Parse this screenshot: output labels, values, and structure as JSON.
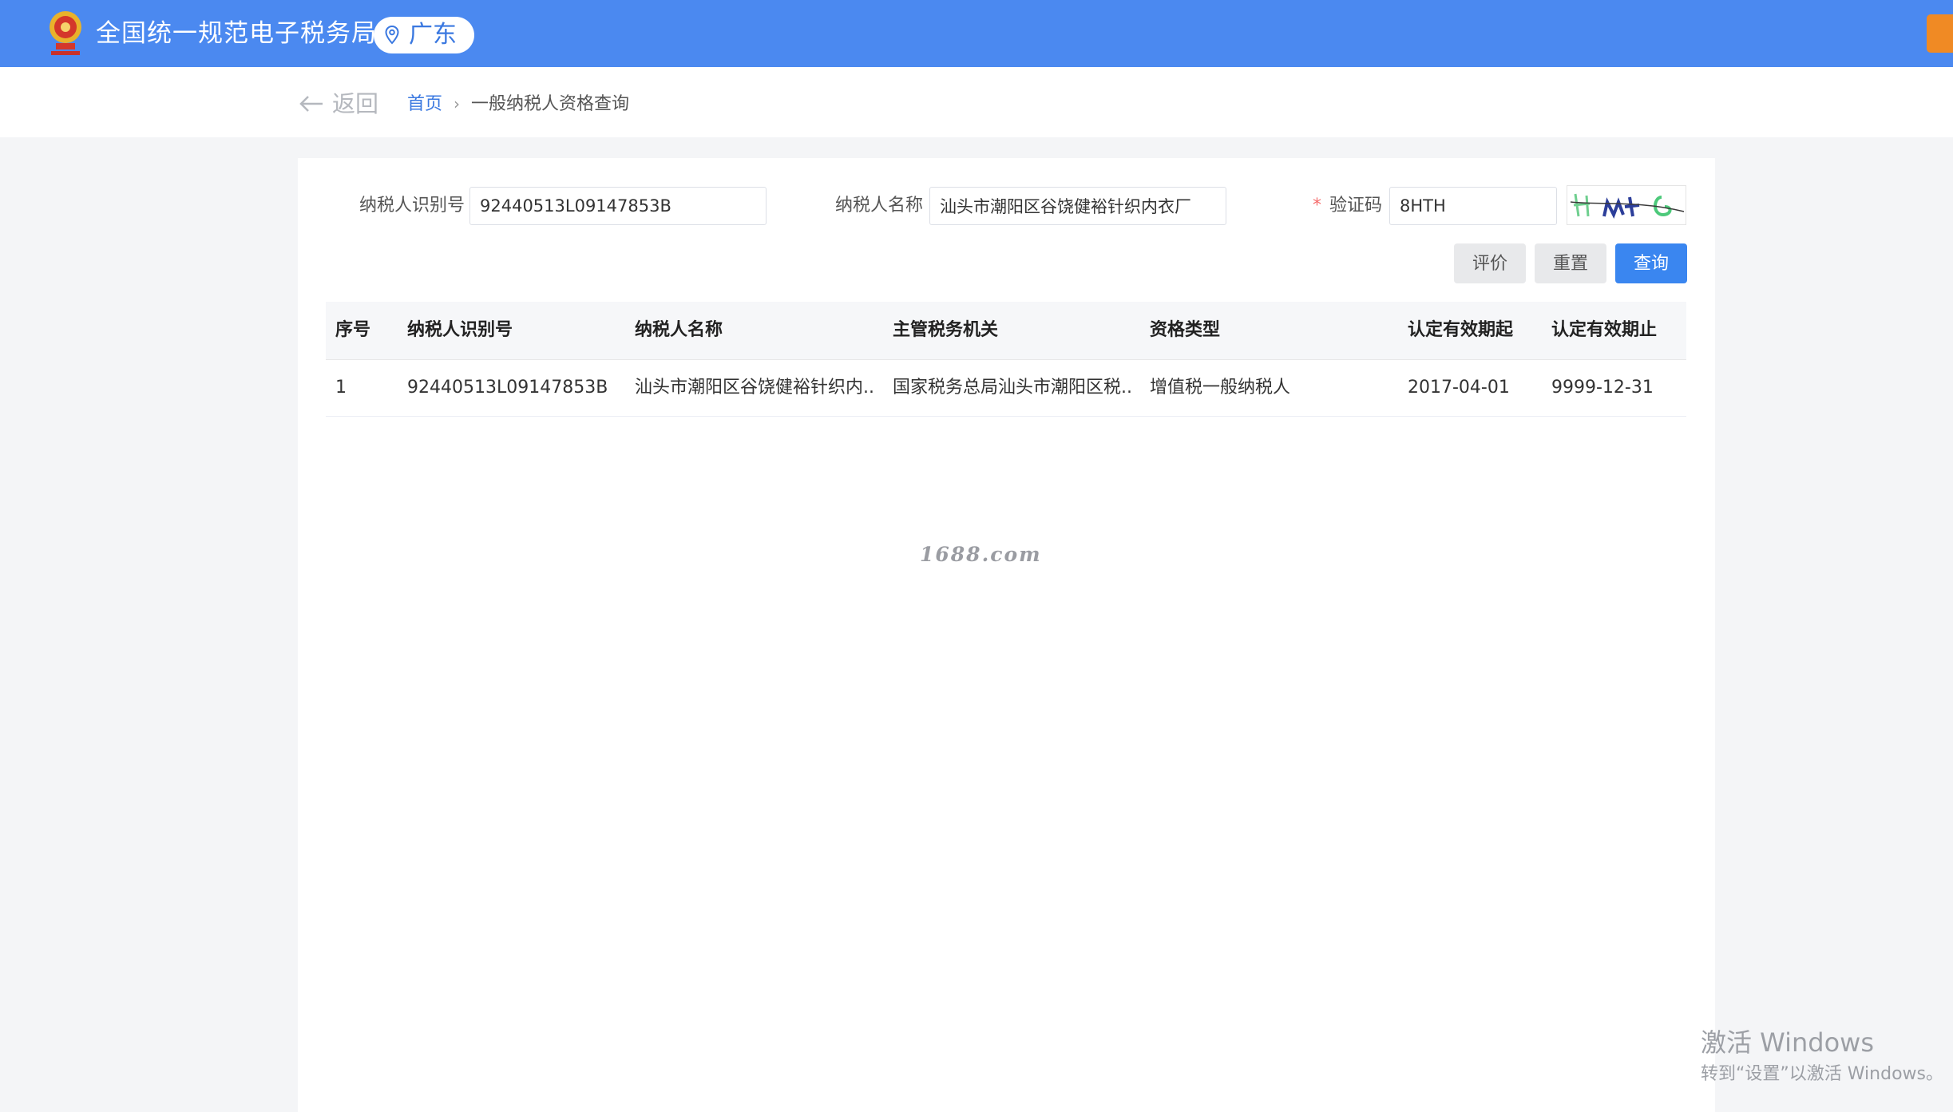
{
  "header": {
    "title": "全国统一规范电子税务局",
    "region": "广东",
    "emblem_icon": "tax-emblem-icon",
    "pin_icon": "location-pin-icon",
    "accent_color": "#4b89f0"
  },
  "nav": {
    "back_label": "返回",
    "breadcrumb": {
      "home": "首页",
      "current": "一般纳税人资格查询"
    }
  },
  "form": {
    "taxpayer_id_label": "纳税人识别号",
    "taxpayer_id_value": "92440513L09147853B",
    "taxpayer_name_label": "纳税人名称",
    "taxpayer_name_value": "汕头市潮阳区谷饶健裕针织内衣厂",
    "captcha_required_mark": "*",
    "captcha_label": "验证码",
    "captcha_value": "8HTH"
  },
  "buttons": {
    "evaluate": "评价",
    "reset": "重置",
    "query": "查询",
    "primary_color": "#3a86f0"
  },
  "table": {
    "headers": [
      "序号",
      "纳税人识别号",
      "纳税人名称",
      "主管税务机关",
      "资格类型",
      "认定有效期起",
      "认定有效期止"
    ],
    "rows": [
      [
        "1",
        "92440513L09147853B",
        "汕头市潮阳区谷饶健裕针织内...",
        "国家税务总局汕头市潮阳区税...",
        "增值税一般纳税人",
        "2017-04-01",
        "9999-12-31"
      ]
    ]
  },
  "watermark": "1688.com",
  "windows_activation": {
    "line1": "激活 Windows",
    "line2": "转到“设置”以激活 Windows。"
  }
}
